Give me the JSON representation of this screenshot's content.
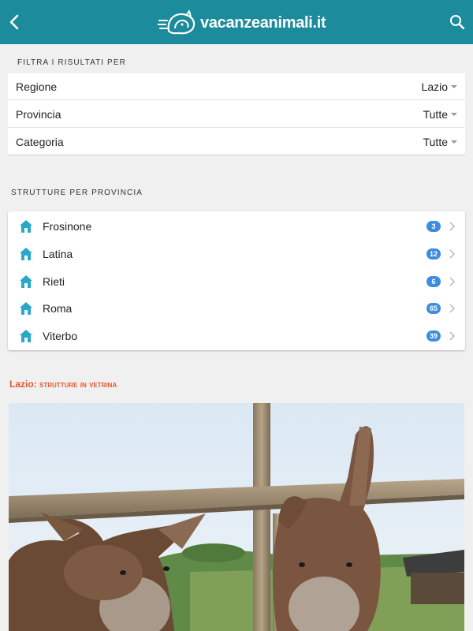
{
  "header": {
    "logo_text": "vacanzeanimali.it",
    "back_icon": "chevron-left-icon",
    "search_icon": "search-icon",
    "bg_color": "#1c8b9c"
  },
  "filters": {
    "section_label": "FILTRA I RISULTATI PER",
    "rows": [
      {
        "label": "Regione",
        "value": "Lazio"
      },
      {
        "label": "Provincia",
        "value": "Tutte"
      },
      {
        "label": "Categoria",
        "value": "Tutte"
      }
    ]
  },
  "provinces": {
    "section_label": "STRUTTURE PER PROVINCIA",
    "icon": "house-icon",
    "badge_color": "#3d8ce0",
    "items": [
      {
        "name": "Frosinone",
        "count": "3"
      },
      {
        "name": "Latina",
        "count": "12"
      },
      {
        "name": "Rieti",
        "count": "6"
      },
      {
        "name": "Roma",
        "count": "65"
      },
      {
        "name": "Viterbo",
        "count": "39"
      }
    ]
  },
  "vetrina": {
    "region": "Lazio:",
    "title_rest": "strutture in vetrina",
    "accent_color": "#e4572e"
  }
}
